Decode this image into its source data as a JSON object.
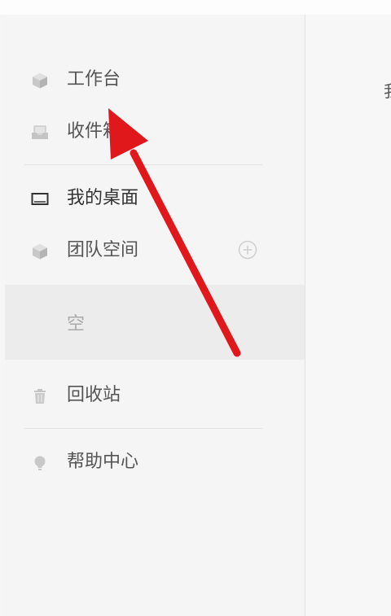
{
  "sidebar": {
    "items": [
      {
        "label": "工作台",
        "icon": "cube-icon"
      },
      {
        "label": "收件箱",
        "icon": "inbox-icon"
      },
      {
        "label": "我的桌面",
        "icon": "desktop-monitor-icon"
      },
      {
        "label": "团队空间",
        "icon": "cube-icon"
      },
      {
        "label": "回收站",
        "icon": "trash-icon"
      },
      {
        "label": "帮助中心",
        "icon": "lightbulb-icon"
      }
    ],
    "team_space_empty": "空",
    "add_icon": "plus-circle-icon"
  },
  "main": {
    "partial_text": "我"
  },
  "annotation": {
    "arrow_color": "#e0181c"
  }
}
